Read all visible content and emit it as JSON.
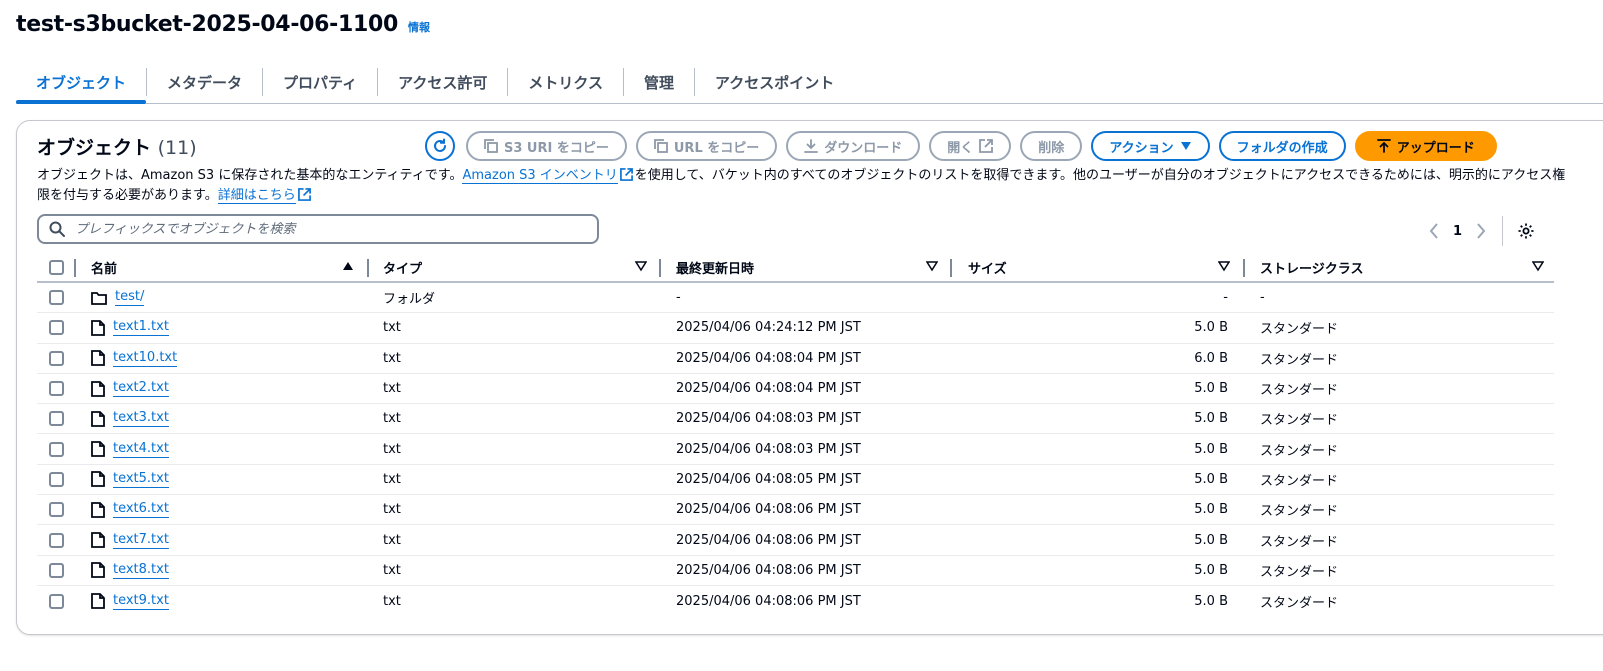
{
  "page": {
    "bucket_name": "test-s3bucket-2025-04-06-1100",
    "info_label": "情報"
  },
  "tabs": [
    {
      "label": "オブジェクト",
      "active": true
    },
    {
      "label": "メタデータ",
      "active": false
    },
    {
      "label": "プロパティ",
      "active": false
    },
    {
      "label": "アクセス許可",
      "active": false
    },
    {
      "label": "メトリクス",
      "active": false
    },
    {
      "label": "管理",
      "active": false
    },
    {
      "label": "アクセスポイント",
      "active": false
    }
  ],
  "panel": {
    "title": "オブジェクト",
    "count": "(11)",
    "description_before": "オブジェクトは、Amazon S3 に保存された基本的なエンティティです。",
    "inventory_link": "Amazon S3 インベントリ",
    "description_middle": "を使用して、バケット内のすべてのオブジェクトのリストを取得できます。他のユーザーが自分のオブジェクトにアクセスできるためには、明示的にアクセス権限を付与する必要があります。",
    "details_link": "詳細はこちら"
  },
  "toolbar": {
    "copy_s3_uri": "S3 URI をコピー",
    "copy_url": "URL をコピー",
    "download": "ダウンロード",
    "open": "開く",
    "delete": "削除",
    "actions": "アクション",
    "create_folder": "フォルダの作成",
    "upload": "アップロード"
  },
  "search": {
    "placeholder": "プレフィックスでオブジェクトを検索"
  },
  "pagination": {
    "current_page": "1"
  },
  "table": {
    "columns": {
      "name": "名前",
      "type": "タイプ",
      "last_modified": "最終更新日時",
      "size": "サイズ",
      "storage_class": "ストレージクラス"
    },
    "rows": [
      {
        "name": "test/",
        "kind": "folder",
        "type": "フォルダ",
        "last_modified": "-",
        "size": "-",
        "storage_class": "-"
      },
      {
        "name": "text1.txt",
        "kind": "file",
        "type": "txt",
        "last_modified": "2025/04/06 04:24:12 PM JST",
        "size": "5.0 B",
        "storage_class": "スタンダード"
      },
      {
        "name": "text10.txt",
        "kind": "file",
        "type": "txt",
        "last_modified": "2025/04/06 04:08:04 PM JST",
        "size": "6.0 B",
        "storage_class": "スタンダード"
      },
      {
        "name": "text2.txt",
        "kind": "file",
        "type": "txt",
        "last_modified": "2025/04/06 04:08:04 PM JST",
        "size": "5.0 B",
        "storage_class": "スタンダード"
      },
      {
        "name": "text3.txt",
        "kind": "file",
        "type": "txt",
        "last_modified": "2025/04/06 04:08:03 PM JST",
        "size": "5.0 B",
        "storage_class": "スタンダード"
      },
      {
        "name": "text4.txt",
        "kind": "file",
        "type": "txt",
        "last_modified": "2025/04/06 04:08:03 PM JST",
        "size": "5.0 B",
        "storage_class": "スタンダード"
      },
      {
        "name": "text5.txt",
        "kind": "file",
        "type": "txt",
        "last_modified": "2025/04/06 04:08:05 PM JST",
        "size": "5.0 B",
        "storage_class": "スタンダード"
      },
      {
        "name": "text6.txt",
        "kind": "file",
        "type": "txt",
        "last_modified": "2025/04/06 04:08:06 PM JST",
        "size": "5.0 B",
        "storage_class": "スタンダード"
      },
      {
        "name": "text7.txt",
        "kind": "file",
        "type": "txt",
        "last_modified": "2025/04/06 04:08:06 PM JST",
        "size": "5.0 B",
        "storage_class": "スタンダード"
      },
      {
        "name": "text8.txt",
        "kind": "file",
        "type": "txt",
        "last_modified": "2025/04/06 04:08:06 PM JST",
        "size": "5.0 B",
        "storage_class": "スタンダード"
      },
      {
        "name": "text9.txt",
        "kind": "file",
        "type": "txt",
        "last_modified": "2025/04/06 04:08:06 PM JST",
        "size": "5.0 B",
        "storage_class": "スタンダード"
      }
    ]
  },
  "colors": {
    "link": "#0972d3",
    "primary_button": "#ff9900",
    "text": "#000716"
  }
}
